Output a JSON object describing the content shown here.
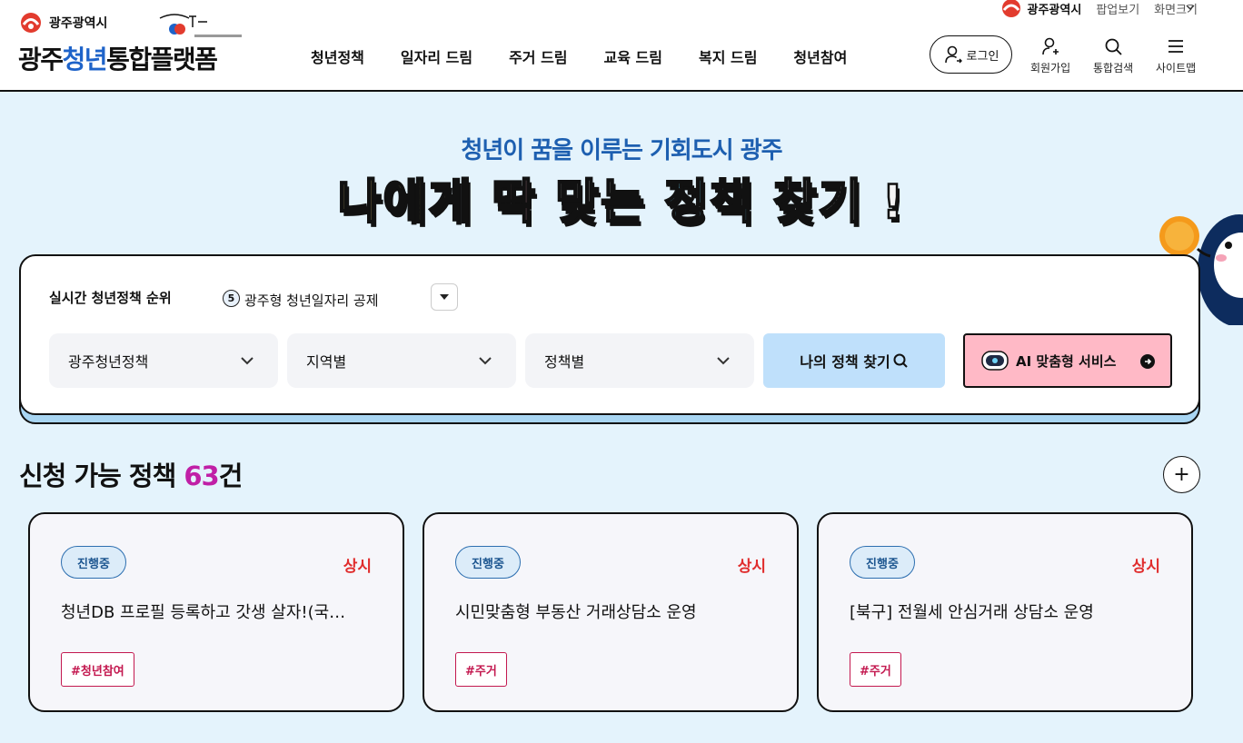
{
  "header": {
    "city_name": "광주광역시",
    "site_title_part1": "광주",
    "site_title_part2": "청년",
    "site_title_part3": "통합플랫폼",
    "util_links": [
      "광주광역시",
      "팝업보기",
      "화면크기"
    ],
    "nav": [
      "청년정책",
      "일자리 드림",
      "주거 드림",
      "교육 드림",
      "복지 드림",
      "청년참여"
    ],
    "login_label": "로그인",
    "join_label": "회원가입",
    "search_label": "통합검색",
    "sitemap_label": "사이트맵"
  },
  "hero": {
    "subtitle": "청년이 꿈을 이루는 기회도시 광주",
    "title_words": [
      "나에게",
      "딱",
      "맞는",
      "정책",
      "찾기",
      "!"
    ]
  },
  "search": {
    "rank_label": "실시간 청년정책 순위",
    "rank_number": "5",
    "rank_text": "광주형 청년일자리 공제",
    "select1": "광주청년정책",
    "select2": "지역별",
    "select3": "정책별",
    "find_button": "나의 정책 찾기",
    "ai_button": "AI 맞춤형 서비스"
  },
  "section": {
    "title_prefix": "신청 가능 정책 ",
    "count": "63",
    "title_suffix": "건",
    "more_label": "+"
  },
  "cards": [
    {
      "status": "진행중",
      "period": "상시",
      "title": "청년DB 프로필 등록하고 갓생 살자!(국…",
      "tag": "#청년참여"
    },
    {
      "status": "진행중",
      "period": "상시",
      "title": "시민맞춤형 부동산 거래상담소 운영",
      "tag": "#주거"
    },
    {
      "status": "진행중",
      "period": "상시",
      "title": "[북구] 전월세 안심거래 상담소 운영",
      "tag": "#주거"
    }
  ],
  "colors": {
    "accent_blue": "#1e63c9",
    "count_magenta": "#c01fa6",
    "status_red": "#e02c2c",
    "tag_crimson": "#c3184f",
    "page_bg": "#e4f3fc"
  }
}
